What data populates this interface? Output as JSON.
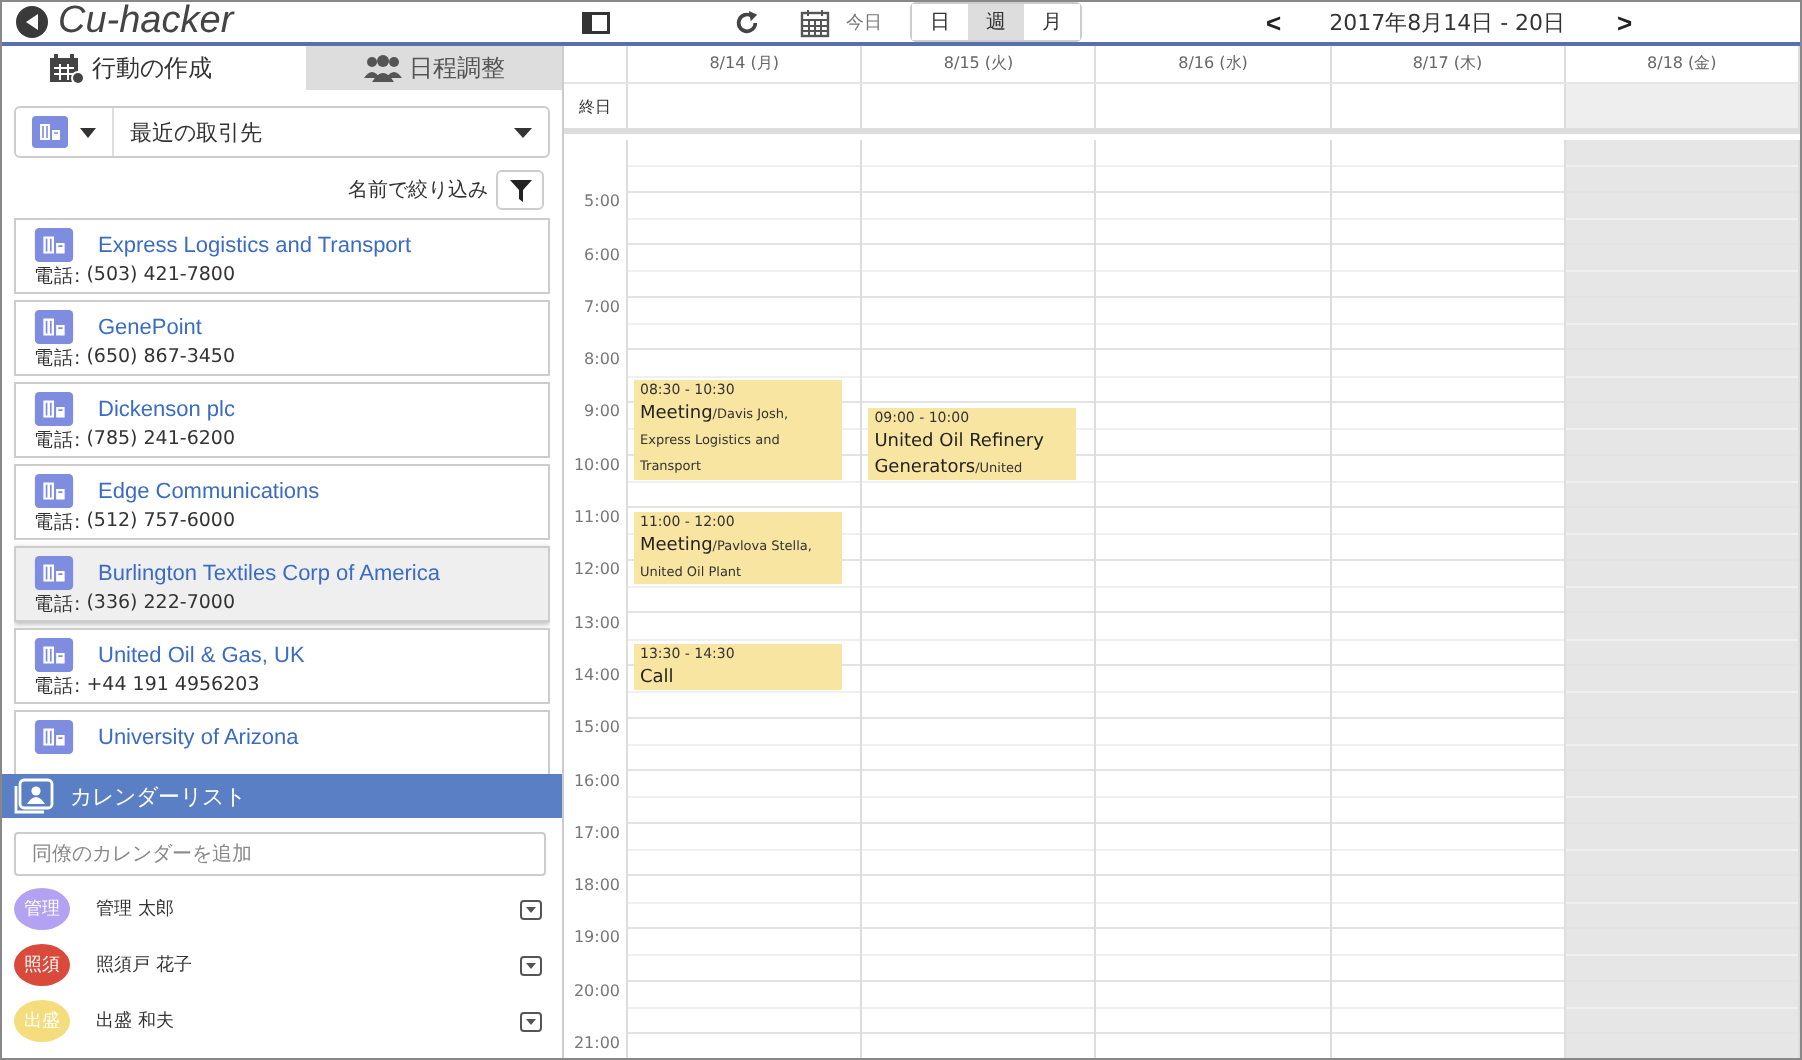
{
  "header": {
    "logo": "Cu-hacker",
    "today": "今日",
    "views": [
      {
        "label": "日",
        "selected": false
      },
      {
        "label": "週",
        "selected": true
      },
      {
        "label": "月",
        "selected": false
      }
    ],
    "prev": "<",
    "date_range": "2017年8月14日 - 20日",
    "next": ">"
  },
  "left_tabs": [
    {
      "label": "行動の作成",
      "selected": true,
      "kind": "calendar"
    },
    {
      "label": "日程調整",
      "selected": false,
      "kind": "people"
    }
  ],
  "object_select": {
    "value": "最近の取引先"
  },
  "filter_label": "名前で絞り込み",
  "accounts": [
    {
      "name": "Express Logistics and Transport",
      "phone_label": "電話:",
      "phone": "(503) 421-7800",
      "selected": false
    },
    {
      "name": "GenePoint",
      "phone_label": "電話:",
      "phone": "(650) 867-3450",
      "selected": false
    },
    {
      "name": "Dickenson plc",
      "phone_label": "電話:",
      "phone": "(785) 241-6200",
      "selected": false
    },
    {
      "name": "Edge Communications",
      "phone_label": "電話:",
      "phone": "(512) 757-6000",
      "selected": false
    },
    {
      "name": "Burlington Textiles Corp of America",
      "phone_label": "電話:",
      "phone": "(336) 222-7000",
      "selected": true
    },
    {
      "name": "United Oil & Gas, UK",
      "phone_label": "電話:",
      "phone": "+44 191 4956203",
      "selected": false
    },
    {
      "name": "University of Arizona",
      "selected": false
    }
  ],
  "calendar_list": {
    "title": "カレンダーリスト",
    "placeholder": "同僚のカレンダーを追加",
    "members": [
      {
        "badge": "管理",
        "name": "管理 太郎",
        "color": "#b3a1f2"
      },
      {
        "badge": "照須",
        "name": "照須戸 花子",
        "color": "#d94a3c"
      },
      {
        "badge": "出盛",
        "name": "出盛 和夫",
        "color": "#f5dc7c"
      }
    ]
  },
  "calendar": {
    "all_day_label": "終日",
    "hours": [
      "5:00",
      "6:00",
      "7:00",
      "8:00",
      "9:00",
      "10:00",
      "11:00",
      "12:00",
      "13:00",
      "14:00",
      "15:00",
      "16:00",
      "17:00",
      "18:00",
      "19:00",
      "20:00",
      "21:00"
    ],
    "days": [
      {
        "label": "8/14 (月)",
        "shaded": false,
        "events": [
          {
            "time": "08:30 - 10:30",
            "title": "Meeting",
            "detail": "/Davis Josh, Express Logistics and Transport"
          },
          {
            "time": "11:00 - 12:00",
            "title": "Meeting",
            "detail": "/Pavlova Stella, United Oil Plant"
          },
          {
            "time": "13:30 - 14:30",
            "title": "Call"
          }
        ]
      },
      {
        "label": "8/15 (火)",
        "shaded": false,
        "events": [
          {
            "time": "09:00 - 10:00",
            "title": "United Oil Refinery Generators",
            "detail": "/United"
          }
        ]
      },
      {
        "label": "8/16 (水)",
        "shaded": false
      },
      {
        "label": "8/17 (木)",
        "shaded": false
      },
      {
        "label": "8/18 (金)",
        "shaded": true
      }
    ]
  }
}
